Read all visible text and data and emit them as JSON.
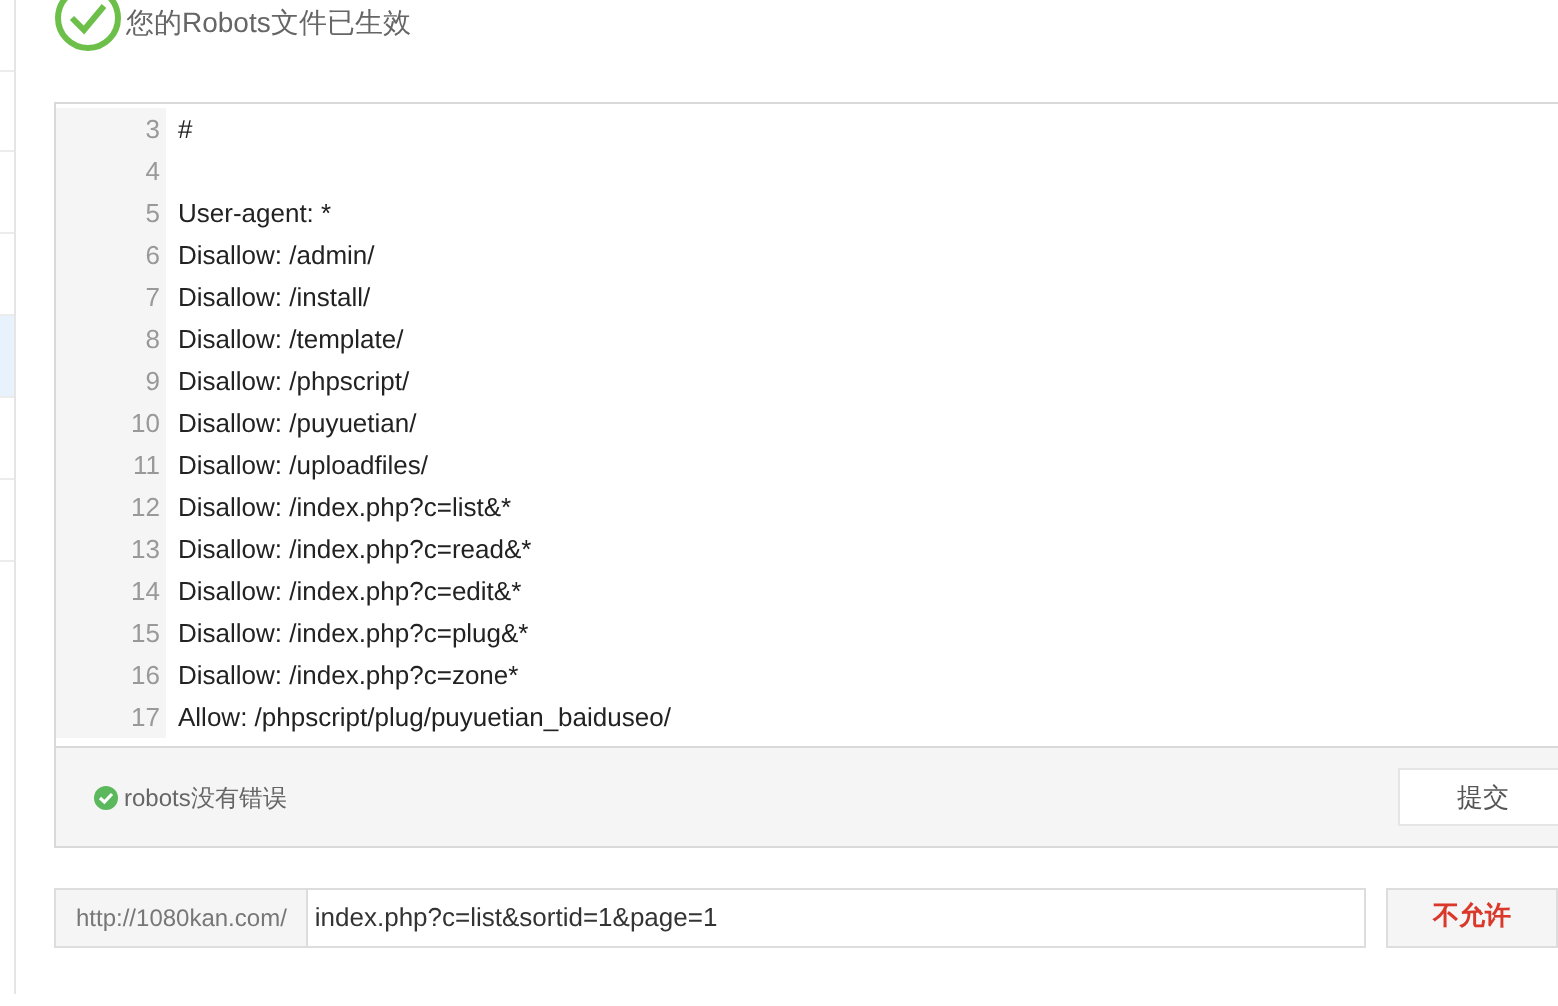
{
  "status": {
    "message": "您的Robots文件已生效"
  },
  "editor": {
    "lines": [
      {
        "number": "3",
        "text": "#"
      },
      {
        "number": "4"
      },
      {
        "number": "5",
        "text": "User-agent: *"
      },
      {
        "number": "6",
        "text": "Disallow: /admin/"
      },
      {
        "number": "7",
        "text": "Disallow: /install/"
      },
      {
        "number": "8",
        "text": "Disallow: /template/"
      },
      {
        "number": "9",
        "text": "Disallow: /phpscript/"
      },
      {
        "number": "10",
        "text": "Disallow: /puyuetian/"
      },
      {
        "number": "11",
        "text": "Disallow: /uploadfiles/"
      },
      {
        "number": "12",
        "text": "Disallow: /index.php?c=list&*"
      },
      {
        "number": "13",
        "text": "Disallow: /index.php?c=read&*"
      },
      {
        "number": "14",
        "text": "Disallow: /index.php?c=edit&*"
      },
      {
        "number": "15",
        "text": "Disallow: /index.php?c=plug&*"
      },
      {
        "number": "16",
        "text": "Disallow: /index.php?c=zone*"
      },
      {
        "number": "17",
        "text": "Allow: /phpscript/plug/puyuetian_baiduseo/"
      }
    ],
    "check": "robots没有错误",
    "submit": "提交"
  },
  "test": {
    "prefix": "http://1080kan.com/",
    "value": "index.php?c=list&sortid=1&page=1",
    "result": "不允许"
  }
}
